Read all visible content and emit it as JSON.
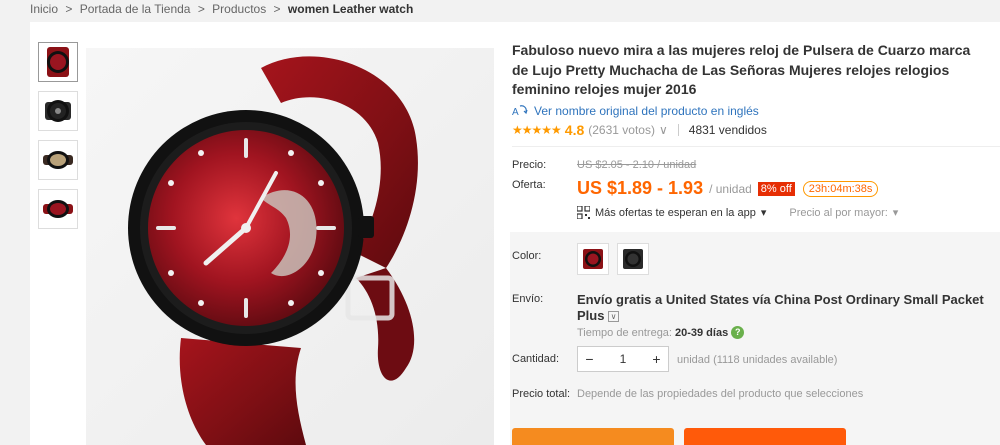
{
  "breadcrumb": {
    "items": [
      "Inicio",
      "Portada de la Tienda",
      "Productos"
    ],
    "separator": ">",
    "current": "women Leather watch"
  },
  "product": {
    "title": "Fabuloso nuevo mira a las mujeres reloj de Pulsera de Cuarzo marca de Lujo Pretty Muchacha de Las Señoras Mujeres relojes relogios feminino relojes mujer 2016",
    "translate_link": "Ver nombre original del producto en inglés",
    "rating": {
      "stars": "★★★★★",
      "value": "4.8",
      "votes": "(2631 votos)",
      "votes_caret": "∨",
      "sold": "4831 vendidos"
    }
  },
  "pricing": {
    "price_label": "Precio:",
    "old_price": "US $2.05 - 2.10 / unidad",
    "offer_label": "Oferta:",
    "price": "US $1.89 - 1.93",
    "unit": "/ unidad",
    "discount": "8% off",
    "timer": "23h:04m:38s",
    "app_offer": "Más ofertas te esperan en la app",
    "wholesale": "Precio al por mayor:",
    "caret": "▾"
  },
  "options": {
    "color_label": "Color:",
    "shipping_label": "Envío:",
    "shipping_text": "Envío gratis a United States vía China Post Ordinary Small Packet Plus",
    "shipping_caret": "∨",
    "delivery_label": "Tiempo de entrega:",
    "delivery_days": "20-39 días",
    "delivery_help": "?",
    "quantity_label": "Cantidad:",
    "quantity_value": "1",
    "minus": "−",
    "plus": "+",
    "available": "unidad (1118 unidades available)",
    "total_label": "Precio total:",
    "total_note": "Depende de las propiedades del producto que selecciones"
  },
  "colors": {
    "strap": "#8b1116",
    "accent_orange": "#f60",
    "discount_red": "#e62e04",
    "link_blue": "#2f74bd"
  }
}
